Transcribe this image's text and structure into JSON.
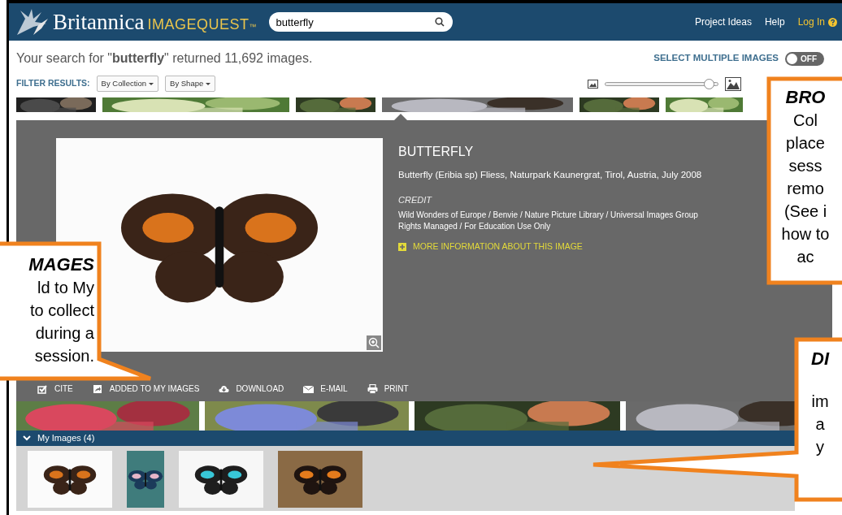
{
  "header": {
    "brand": "Britannica",
    "product": "IMAGEQUEST",
    "trademark": "™",
    "search": {
      "value": "butterfly"
    },
    "links": [
      {
        "label": "Project Ideas",
        "kind": "link"
      },
      {
        "label": "Help",
        "kind": "link"
      },
      {
        "label": "Log In",
        "kind": "login"
      }
    ]
  },
  "results": {
    "summary": "Your search for \"**butterfly**\" returned 11,692 images.",
    "select_multiple": {
      "label": "SELECT MULTIPLE IMAGES",
      "on": false,
      "state_label": "OFF"
    }
  },
  "filters": {
    "label": "FILTER RESULTS:",
    "dropdowns": [
      "By Collection",
      "By Shape"
    ]
  },
  "size_slider": {
    "level": 0.92
  },
  "detail": {
    "title": "BUTTERFLY",
    "caption": "Butterfly (Eribia sp) Fliess, Naturpark Kaunergrat, Tirol, Austria, July 2008",
    "credit_label": "CREDIT",
    "credit_lines": [
      "Wild Wonders of Europe / Benvie / Nature Picture Library / Universal Images Group",
      "Rights Managed / For Education Use Only"
    ],
    "more_info": "MORE INFORMATION ABOUT THIS IMAGE",
    "actions": [
      {
        "label": "CITE",
        "kind": "cite"
      },
      {
        "label": "ADDED TO MY IMAGES",
        "kind": "add"
      },
      {
        "label": "DOWNLOAD",
        "kind": "download"
      },
      {
        "label": "E-MAIL",
        "kind": "email"
      },
      {
        "label": "PRINT",
        "kind": "print"
      }
    ]
  },
  "my_images": {
    "title": "My Images (4)",
    "expanded": true
  },
  "callouts": [
    {
      "kind": "left",
      "heading": "MAGES",
      "lines": [
        "ld to My",
        "to collect",
        "during a",
        "session."
      ]
    },
    {
      "kind": "top_right",
      "heading": "BRO",
      "lines": [
        "Col",
        "place",
        "sess",
        "remo",
        "(See i",
        "how to",
        "ac"
      ]
    },
    {
      "kind": "bottom_right",
      "heading": "DI",
      "lines": [
        "im",
        "a",
        "y"
      ]
    }
  ]
}
